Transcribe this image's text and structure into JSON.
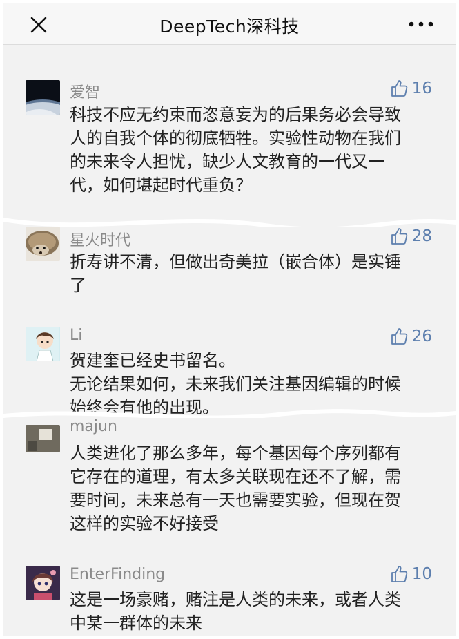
{
  "header": {
    "title": "DeepTech深科技"
  },
  "comments": [
    {
      "name": "爱智",
      "likes": "16",
      "lines": [
        "科技不应无约束而恣意妄为的后果务必会导致",
        "人的自我个体的彻底牺牲。实验性动物在我们",
        "的未来令人担忧，缺少人文教育的一代又一",
        "代，如何堪起时代重负？"
      ]
    },
    {
      "name": "星火时代",
      "likes": "28",
      "lines": [
        "折寿讲不清，但做出奇美拉（嵌合体）是实锤",
        "了"
      ]
    },
    {
      "name": "Li",
      "likes": "26",
      "lines": [
        "贺建奎已经史书留名。",
        "无论结果如何，未来我们关注基因编辑的时候",
        "始终会有他的出现。"
      ]
    },
    {
      "name": "majun",
      "lines": [
        "人类进化了那么多年，每个基因每个序列都有",
        "它存在的道理，有太多关联现在还不了解，需",
        "要时间，未来总有一天也需要实验，但现在贺",
        "这样的实验不好接受"
      ]
    },
    {
      "name": "EnterFinding",
      "likes": "10",
      "lines": [
        "这是一场豪赌，赌注是人类的未来，或者人类",
        "中某一群体的未来"
      ]
    }
  ],
  "colors": {
    "like_blue": "#5d7fae",
    "name_gray": "#8a8a8a",
    "background": "#f2f2f2"
  }
}
